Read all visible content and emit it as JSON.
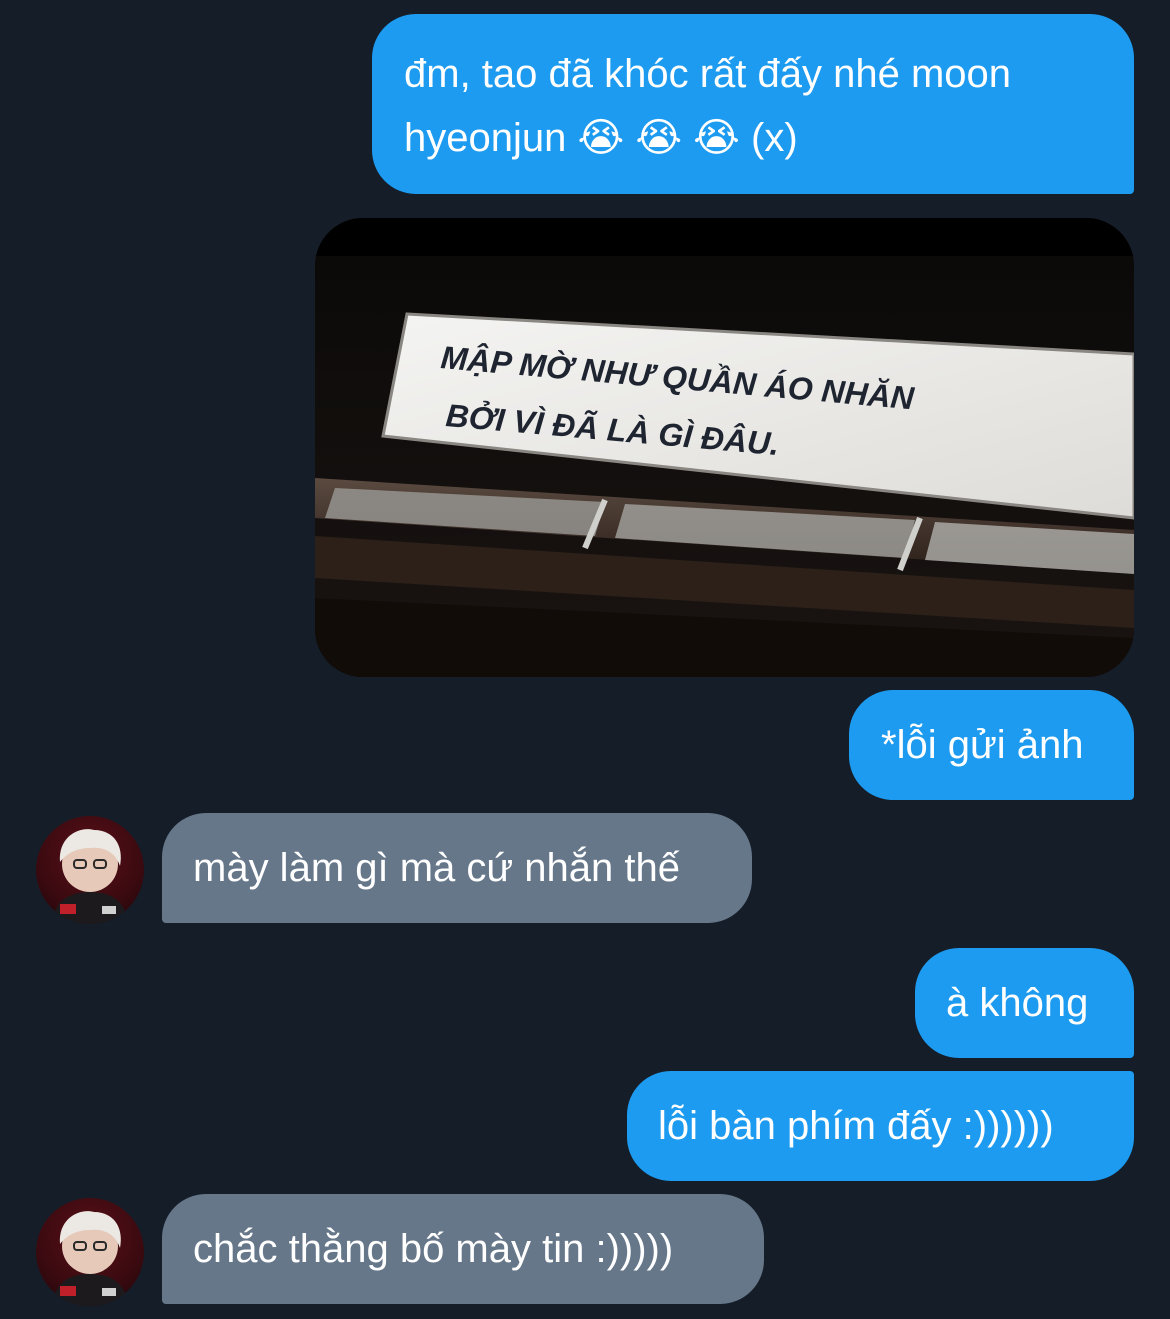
{
  "conversation": {
    "messages": [
      {
        "sender": "me",
        "text": "đm, tao đã khóc rất đấy nhé moon\nhyeonjun 😭 😭 😭 (x)"
      },
      {
        "sender": "me",
        "type": "image",
        "image_text": [
          "MẬP MỜ NHƯ QUẦN ÁO NHĂN",
          "BỞI VÌ ĐÃ LÀ GÌ ĐÂU."
        ]
      },
      {
        "sender": "me",
        "text": "*lỗi gửi ảnh"
      },
      {
        "sender": "them",
        "text": "mày làm gì mà cứ nhắn thế"
      },
      {
        "sender": "me",
        "text": "à không"
      },
      {
        "sender": "me",
        "text": "lỗi bàn phím đấy :))))))"
      },
      {
        "sender": "them",
        "text": "chắc thằng bố mày tin :)))))"
      }
    ]
  },
  "colors": {
    "background": "#151d28",
    "outgoing_bubble": "#1d9bf0",
    "incoming_bubble": "#66778a",
    "text": "#ffffff"
  }
}
